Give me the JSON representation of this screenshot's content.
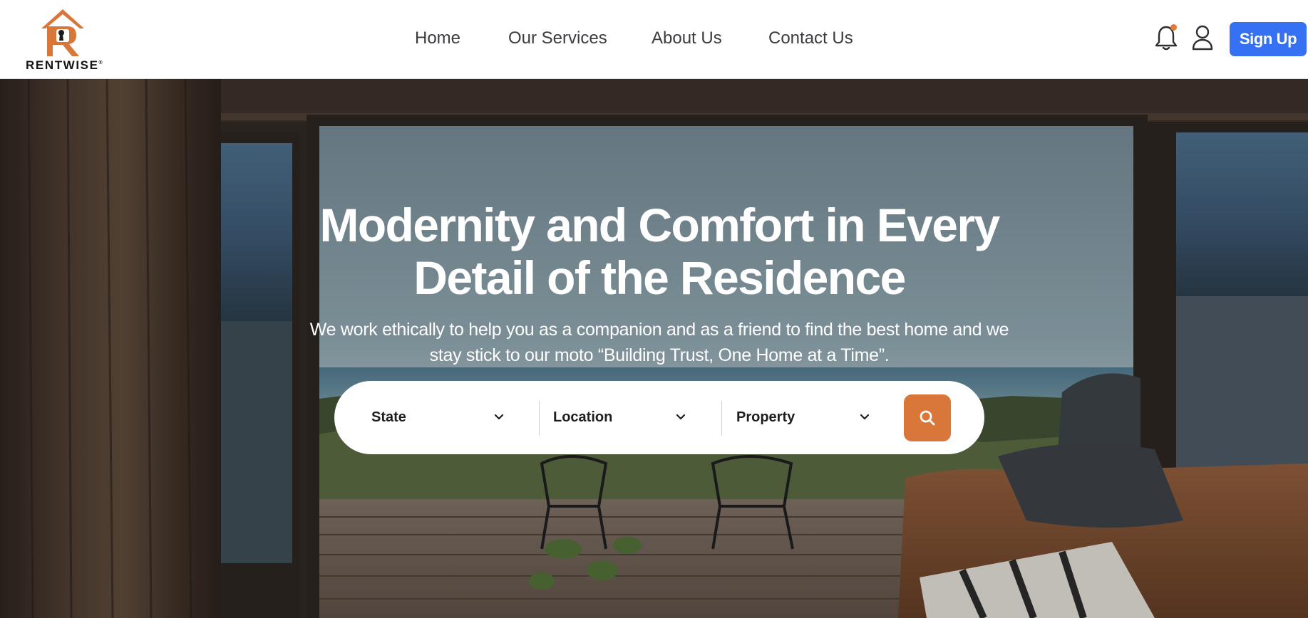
{
  "brand": {
    "name": "RENTWISE",
    "trademark": "®",
    "accent_color": "#d9773a"
  },
  "nav": {
    "home": "Home",
    "services": "Our Services",
    "about": "About Us",
    "contact": "Contact Us"
  },
  "header": {
    "notification_icon": "bell-icon",
    "notification_dot_color": "#e07a39",
    "user_icon": "user-icon",
    "signup_label": "Sign Up",
    "signup_color": "#3571f2"
  },
  "hero": {
    "title": "Modernity and Comfort in Every Detail of the Residence",
    "subtitle": "We work ethically to help you as a companion and as a friend to find the best home and we stay stick to our moto “Building Trust, One Home at a Time”."
  },
  "search": {
    "state_label": "State",
    "location_label": "Location",
    "property_label": "Property",
    "button_icon": "search-icon",
    "button_color": "#d9773a"
  }
}
